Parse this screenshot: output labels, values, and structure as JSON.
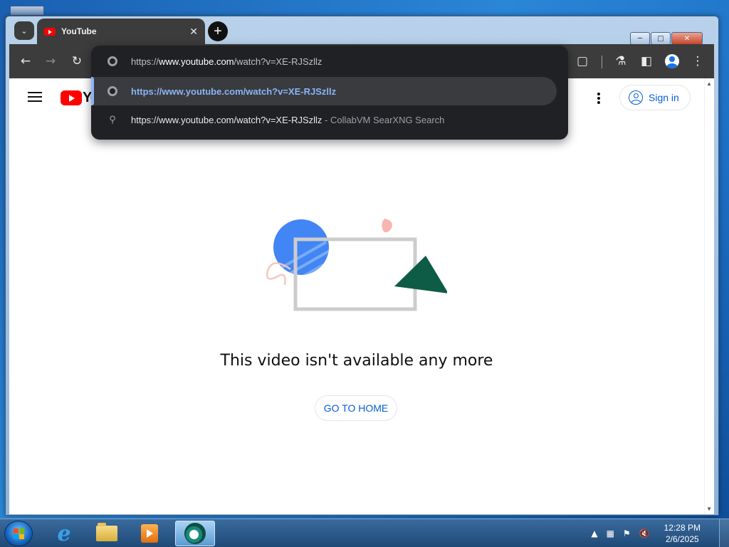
{
  "browser": {
    "tab": {
      "title": "YouTube"
    },
    "toolbar": {
      "back_icon": "arrow-left",
      "forward_icon": "arrow-right",
      "reload_icon": "reload"
    },
    "omnibox": {
      "input": {
        "prefix": "https://",
        "host": "www.youtube.com",
        "path": "/watch?v=XE-RJSzllz"
      },
      "suggestions": [
        {
          "icon": "globe-icon",
          "text": "https://www.youtube.com/watch?v=XE-RJSzllz"
        },
        {
          "icon": "search-icon",
          "text": "https://www.youtube.com/watch?v=XE-RJSzllz",
          "suffix": " - CollabVM SearXNG Search"
        }
      ]
    }
  },
  "page": {
    "logo_text": "Yo",
    "sign_in_label": "Sign in",
    "error_message": "This video isn't available any more",
    "go_home_label": "GO TO HOME"
  },
  "taskbar": {
    "clock": {
      "time": "12:28 PM",
      "date": "2/6/2025"
    }
  },
  "colors": {
    "accent_blue": "#065fd4",
    "youtube_red": "#ff0000",
    "omnibox_bg": "#202124",
    "omnibox_highlight_text": "#8ab4f8"
  }
}
